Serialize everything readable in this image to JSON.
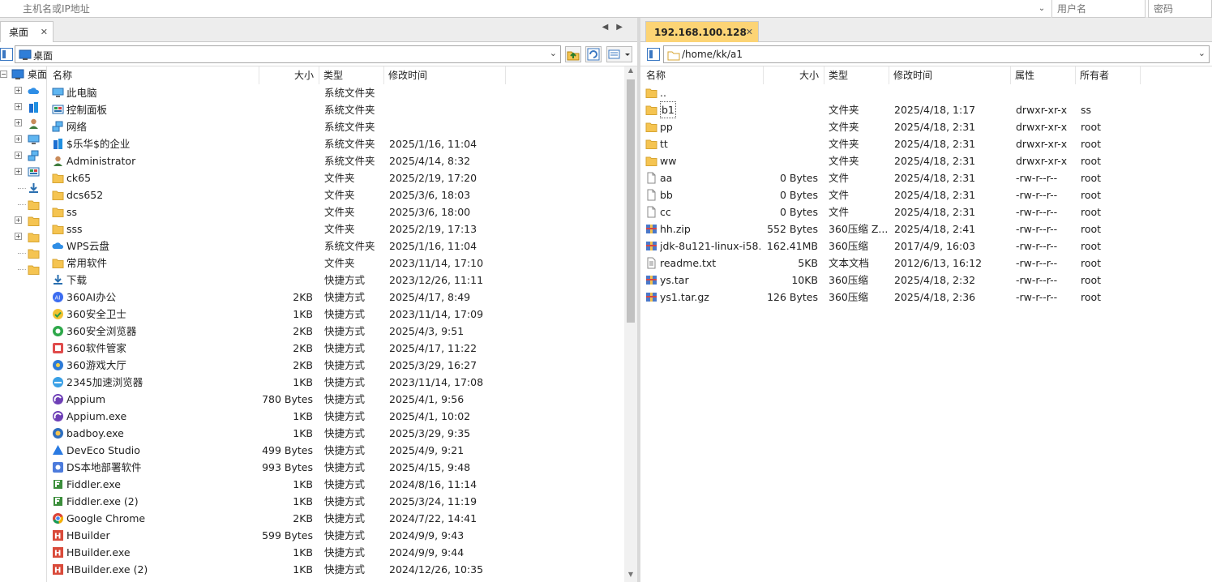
{
  "connection": {
    "host_placeholder": "主机名或IP地址",
    "user_placeholder": "用户名",
    "pass_placeholder": "密码"
  },
  "left": {
    "tab_label": "桌面",
    "path": "桌面",
    "tree_root_label": "桌面",
    "columns": {
      "name": "名称",
      "size": "大小",
      "type": "类型",
      "mtime": "修改时间"
    },
    "files": [
      {
        "name": "此电脑",
        "size": "",
        "type": "系统文件夹",
        "mtime": "",
        "icon": "computer"
      },
      {
        "name": "控制面板",
        "size": "",
        "type": "系统文件夹",
        "mtime": "",
        "icon": "control-panel"
      },
      {
        "name": "网络",
        "size": "",
        "type": "系统文件夹",
        "mtime": "",
        "icon": "network"
      },
      {
        "name": "$乐华$的企业",
        "size": "",
        "type": "系统文件夹",
        "mtime": "2025/1/16, 11:04",
        "icon": "enterprise"
      },
      {
        "name": "Administrator",
        "size": "",
        "type": "系统文件夹",
        "mtime": "2025/4/14, 8:32",
        "icon": "user"
      },
      {
        "name": "ck65",
        "size": "",
        "type": "文件夹",
        "mtime": "2025/2/19, 17:20",
        "icon": "folder"
      },
      {
        "name": "dcs652",
        "size": "",
        "type": "文件夹",
        "mtime": "2025/3/6, 18:03",
        "icon": "folder"
      },
      {
        "name": "ss",
        "size": "",
        "type": "文件夹",
        "mtime": "2025/3/6, 18:00",
        "icon": "folder"
      },
      {
        "name": "sss",
        "size": "",
        "type": "文件夹",
        "mtime": "2025/2/19, 17:13",
        "icon": "folder"
      },
      {
        "name": "WPS云盘",
        "size": "",
        "type": "系统文件夹",
        "mtime": "2025/1/16, 11:04",
        "icon": "cloud"
      },
      {
        "name": "常用软件",
        "size": "",
        "type": "文件夹",
        "mtime": "2023/11/14, 17:10",
        "icon": "folder"
      },
      {
        "name": "下载",
        "size": "",
        "type": "快捷方式",
        "mtime": "2023/12/26, 11:11",
        "icon": "download"
      },
      {
        "name": "360AI办公",
        "size": "2KB",
        "type": "快捷方式",
        "mtime": "2025/4/17, 8:49",
        "icon": "app-360ai"
      },
      {
        "name": "360安全卫士",
        "size": "1KB",
        "type": "快捷方式",
        "mtime": "2023/11/14, 17:09",
        "icon": "app-360safe"
      },
      {
        "name": "360安全浏览器",
        "size": "2KB",
        "type": "快捷方式",
        "mtime": "2025/4/3, 9:51",
        "icon": "app-360browser"
      },
      {
        "name": "360软件管家",
        "size": "2KB",
        "type": "快捷方式",
        "mtime": "2025/4/17, 11:22",
        "icon": "app-360soft"
      },
      {
        "name": "360游戏大厅",
        "size": "2KB",
        "type": "快捷方式",
        "mtime": "2025/3/29, 16:27",
        "icon": "app-360game"
      },
      {
        "name": "2345加速浏览器",
        "size": "1KB",
        "type": "快捷方式",
        "mtime": "2023/11/14, 17:08",
        "icon": "app-2345"
      },
      {
        "name": "Appium",
        "size": "780 Bytes",
        "type": "快捷方式",
        "mtime": "2025/4/1, 9:56",
        "icon": "app-appium"
      },
      {
        "name": "Appium.exe",
        "size": "1KB",
        "type": "快捷方式",
        "mtime": "2025/4/1, 10:02",
        "icon": "app-appium"
      },
      {
        "name": "badboy.exe",
        "size": "1KB",
        "type": "快捷方式",
        "mtime": "2025/3/29, 9:35",
        "icon": "app-badboy"
      },
      {
        "name": "DevEco Studio",
        "size": "499 Bytes",
        "type": "快捷方式",
        "mtime": "2025/4/9, 9:21",
        "icon": "app-deveco"
      },
      {
        "name": "DS本地部署软件",
        "size": "993 Bytes",
        "type": "快捷方式",
        "mtime": "2025/4/15, 9:48",
        "icon": "app-ds"
      },
      {
        "name": "Fiddler.exe",
        "size": "1KB",
        "type": "快捷方式",
        "mtime": "2024/8/16, 11:14",
        "icon": "app-fiddler"
      },
      {
        "name": "Fiddler.exe (2)",
        "size": "1KB",
        "type": "快捷方式",
        "mtime": "2025/3/24, 11:19",
        "icon": "app-fiddler"
      },
      {
        "name": "Google Chrome",
        "size": "2KB",
        "type": "快捷方式",
        "mtime": "2024/7/22, 14:41",
        "icon": "app-chrome"
      },
      {
        "name": "HBuilder",
        "size": "599 Bytes",
        "type": "快捷方式",
        "mtime": "2024/9/9, 9:43",
        "icon": "app-hbuilder"
      },
      {
        "name": "HBuilder.exe",
        "size": "1KB",
        "type": "快捷方式",
        "mtime": "2024/9/9, 9:44",
        "icon": "app-hbuilder"
      },
      {
        "name": "HBuilder.exe (2)",
        "size": "1KB",
        "type": "快捷方式",
        "mtime": "2024/12/26, 10:35",
        "icon": "app-hbuilder"
      }
    ]
  },
  "right": {
    "tab_label": "192.168.100.128",
    "path": "/home/kk/a1",
    "columns": {
      "name": "名称",
      "size": "大小",
      "type": "类型",
      "mtime": "修改时间",
      "perm": "属性",
      "owner": "所有者"
    },
    "files": [
      {
        "name": "..",
        "size": "",
        "type": "",
        "mtime": "",
        "perm": "",
        "owner": "",
        "icon": "folder"
      },
      {
        "name": "b1",
        "size": "",
        "type": "文件夹",
        "mtime": "2025/4/18, 1:17",
        "perm": "drwxr-xr-x",
        "owner": "ss",
        "icon": "folder"
      },
      {
        "name": "pp",
        "size": "",
        "type": "文件夹",
        "mtime": "2025/4/18, 2:31",
        "perm": "drwxr-xr-x",
        "owner": "root",
        "icon": "folder"
      },
      {
        "name": "tt",
        "size": "",
        "type": "文件夹",
        "mtime": "2025/4/18, 2:31",
        "perm": "drwxr-xr-x",
        "owner": "root",
        "icon": "folder"
      },
      {
        "name": "ww",
        "size": "",
        "type": "文件夹",
        "mtime": "2025/4/18, 2:31",
        "perm": "drwxr-xr-x",
        "owner": "root",
        "icon": "folder"
      },
      {
        "name": "aa",
        "size": "0 Bytes",
        "type": "文件",
        "mtime": "2025/4/18, 2:31",
        "perm": "-rw-r--r--",
        "owner": "root",
        "icon": "file"
      },
      {
        "name": "bb",
        "size": "0 Bytes",
        "type": "文件",
        "mtime": "2025/4/18, 2:31",
        "perm": "-rw-r--r--",
        "owner": "root",
        "icon": "file"
      },
      {
        "name": "cc",
        "size": "0 Bytes",
        "type": "文件",
        "mtime": "2025/4/18, 2:31",
        "perm": "-rw-r--r--",
        "owner": "root",
        "icon": "file"
      },
      {
        "name": "hh.zip",
        "size": "552 Bytes",
        "type": "360压缩 Z...",
        "mtime": "2025/4/18, 2:41",
        "perm": "-rw-r--r--",
        "owner": "root",
        "icon": "archive"
      },
      {
        "name": "jdk-8u121-linux-i58...",
        "size": "162.41MB",
        "type": "360压缩",
        "mtime": "2017/4/9, 16:03",
        "perm": "-rw-r--r--",
        "owner": "root",
        "icon": "archive"
      },
      {
        "name": "readme.txt",
        "size": "5KB",
        "type": "文本文档",
        "mtime": "2012/6/13, 16:12",
        "perm": "-rw-r--r--",
        "owner": "root",
        "icon": "text"
      },
      {
        "name": "ys.tar",
        "size": "10KB",
        "type": "360压缩",
        "mtime": "2025/4/18, 2:32",
        "perm": "-rw-r--r--",
        "owner": "root",
        "icon": "archive"
      },
      {
        "name": "ys1.tar.gz",
        "size": "126 Bytes",
        "type": "360压缩",
        "mtime": "2025/4/18, 2:36",
        "perm": "-rw-r--r--",
        "owner": "root",
        "icon": "archive"
      }
    ]
  },
  "colors": {
    "active_tab": "#fcd475",
    "folder": "#f5c451",
    "selection_border": "#7a7a7a"
  }
}
